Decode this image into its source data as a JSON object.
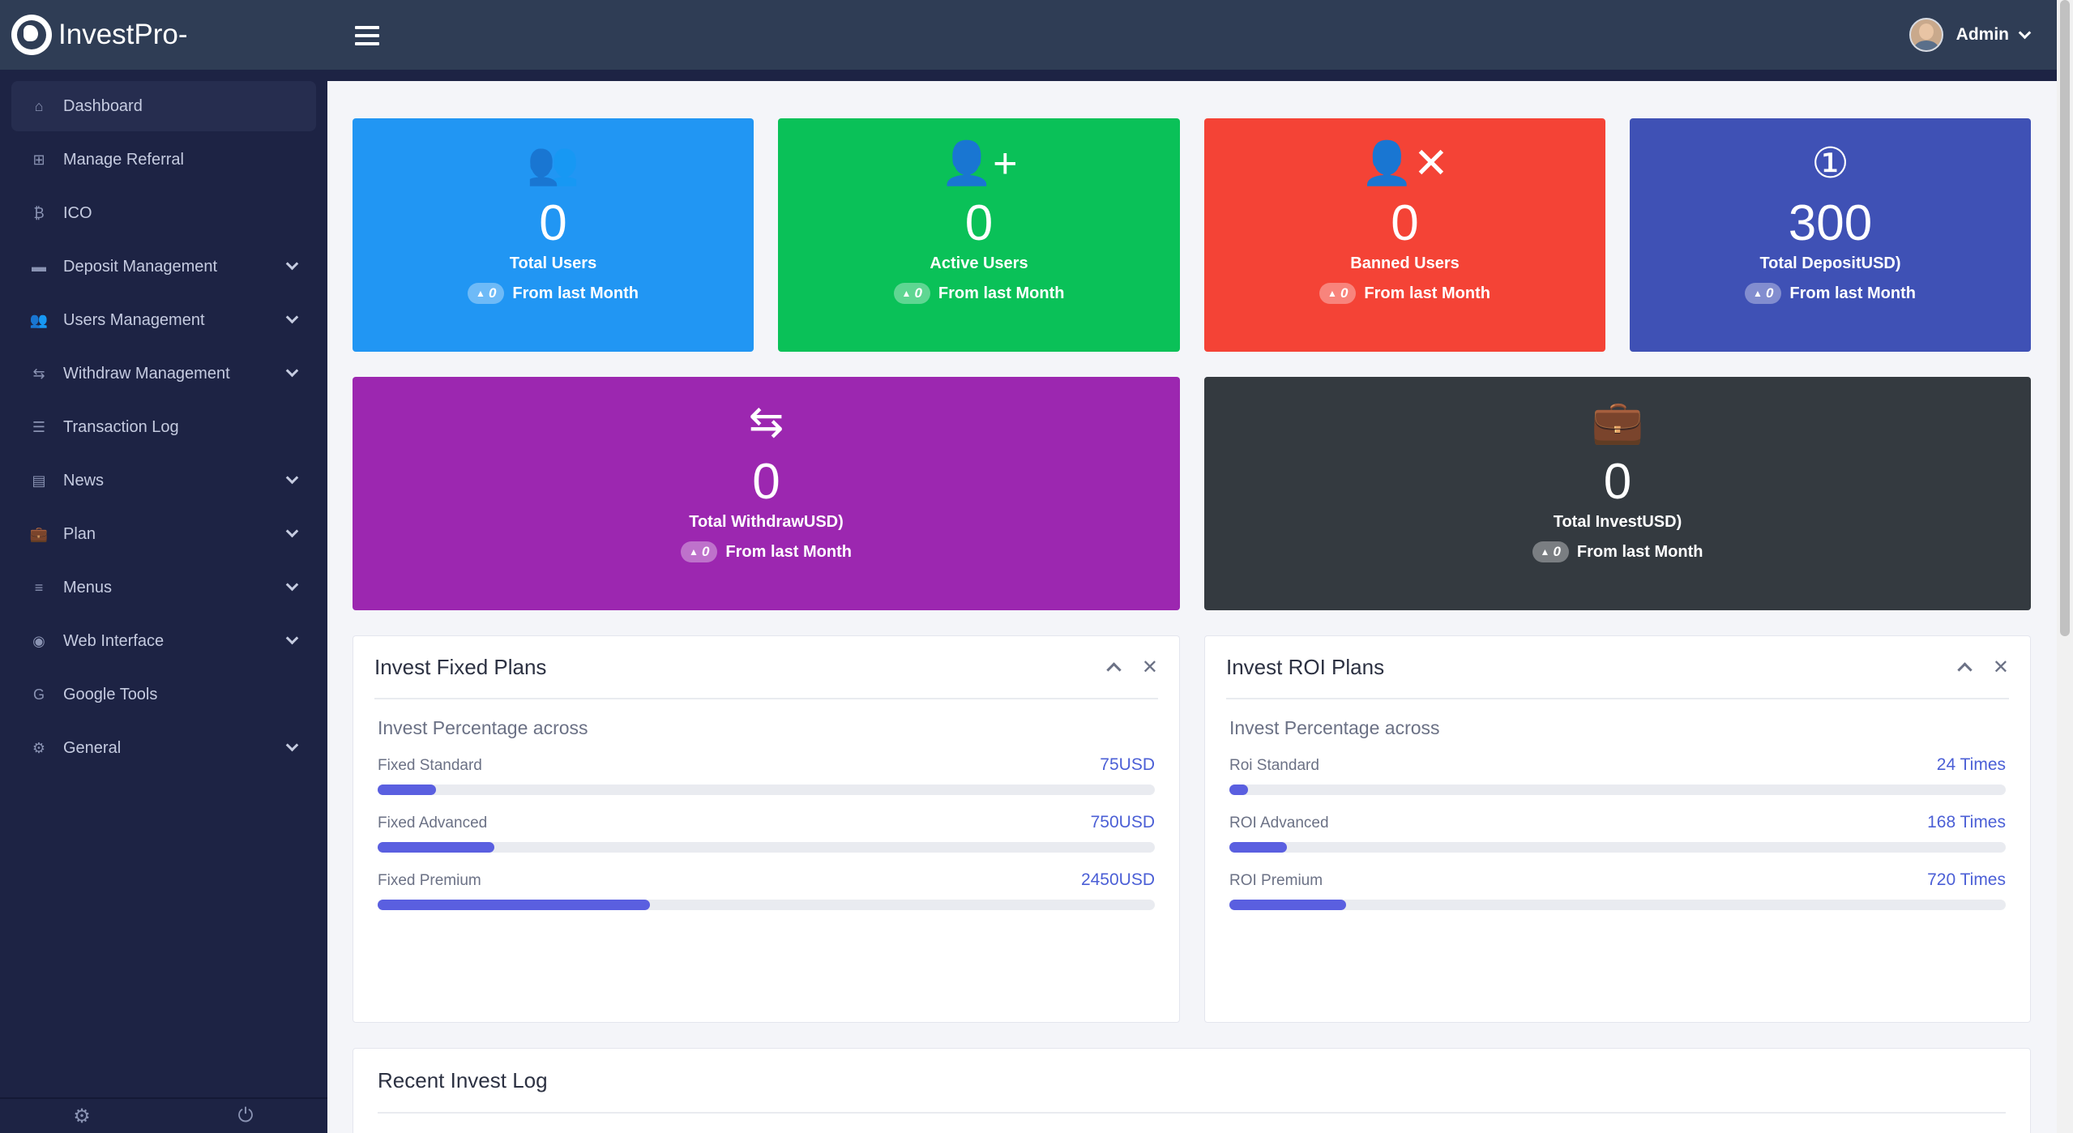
{
  "brand": {
    "name": "InvestPro-"
  },
  "user": {
    "name": "Admin"
  },
  "sidebar": {
    "items": [
      {
        "label": "Dashboard",
        "icon": "home-icon",
        "chevron": false,
        "active": true
      },
      {
        "label": "Manage Referral",
        "icon": "sitemap-icon",
        "chevron": false
      },
      {
        "label": "ICO",
        "icon": "bitcoin-icon",
        "chevron": false
      },
      {
        "label": "Deposit Management",
        "icon": "credit-card-icon",
        "chevron": true
      },
      {
        "label": "Users Management",
        "icon": "users-icon",
        "chevron": true
      },
      {
        "label": "Withdraw Management",
        "icon": "retweet-icon",
        "chevron": true
      },
      {
        "label": "Transaction Log",
        "icon": "list-icon",
        "chevron": false
      },
      {
        "label": "News",
        "icon": "newspaper-icon",
        "chevron": true
      },
      {
        "label": "Plan",
        "icon": "briefcase-icon",
        "chevron": true
      },
      {
        "label": "Menus",
        "icon": "bars-icon",
        "chevron": true
      },
      {
        "label": "Web Interface",
        "icon": "globe-icon",
        "chevron": true
      },
      {
        "label": "Google Tools",
        "icon": "google-icon",
        "chevron": false
      },
      {
        "label": "General",
        "icon": "gear-icon",
        "chevron": true
      }
    ]
  },
  "stats": [
    {
      "value": "0",
      "label": "Total Users",
      "badge": "0",
      "footer": "From last Month",
      "color": "#2196f3",
      "icon": "users-icon"
    },
    {
      "value": "0",
      "label": "Active Users",
      "badge": "0",
      "footer": "From last Month",
      "color": "#0ac158",
      "icon": "user-plus-icon"
    },
    {
      "value": "0",
      "label": "Banned Users",
      "badge": "0",
      "footer": "From last Month",
      "color": "#f44336",
      "icon": "user-times-icon"
    },
    {
      "value": "300",
      "label": "Total DepositUSD)",
      "badge": "0",
      "footer": "From last Month",
      "color": "#3f51b5",
      "icon": "money-bill-icon"
    },
    {
      "value": "0",
      "label": "Total WithdrawUSD)",
      "badge": "0",
      "footer": "From last Month",
      "color": "#9c27b0",
      "icon": "retweet-icon"
    },
    {
      "value": "0",
      "label": "Total InvestUSD)",
      "badge": "0",
      "footer": "From last Month",
      "color": "#343a40",
      "icon": "briefcase-icon"
    }
  ],
  "fixed_plans": {
    "title": "Invest Fixed Plans",
    "subtitle": "Invest Percentage across",
    "rows": [
      {
        "name": "Fixed Standard",
        "value": "75USD",
        "fill": 0.075
      },
      {
        "name": "Fixed Advanced",
        "value": "750USD",
        "fill": 0.15
      },
      {
        "name": "Fixed Premium",
        "value": "2450USD",
        "fill": 0.35
      }
    ]
  },
  "roi_plans": {
    "title": "Invest ROI Plans",
    "subtitle": "Invest Percentage across",
    "rows": [
      {
        "name": "Roi Standard",
        "value": "24 Times",
        "fill": 0.024
      },
      {
        "name": "ROI Advanced",
        "value": "168 Times",
        "fill": 0.074
      },
      {
        "name": "ROI Premium",
        "value": "720 Times",
        "fill": 0.15
      }
    ]
  },
  "recent_log": {
    "title": "Recent Invest Log"
  },
  "colors": {
    "sidebar": "#1d2344",
    "topbar": "#2f3d55",
    "accent": "#5a5fe0"
  }
}
